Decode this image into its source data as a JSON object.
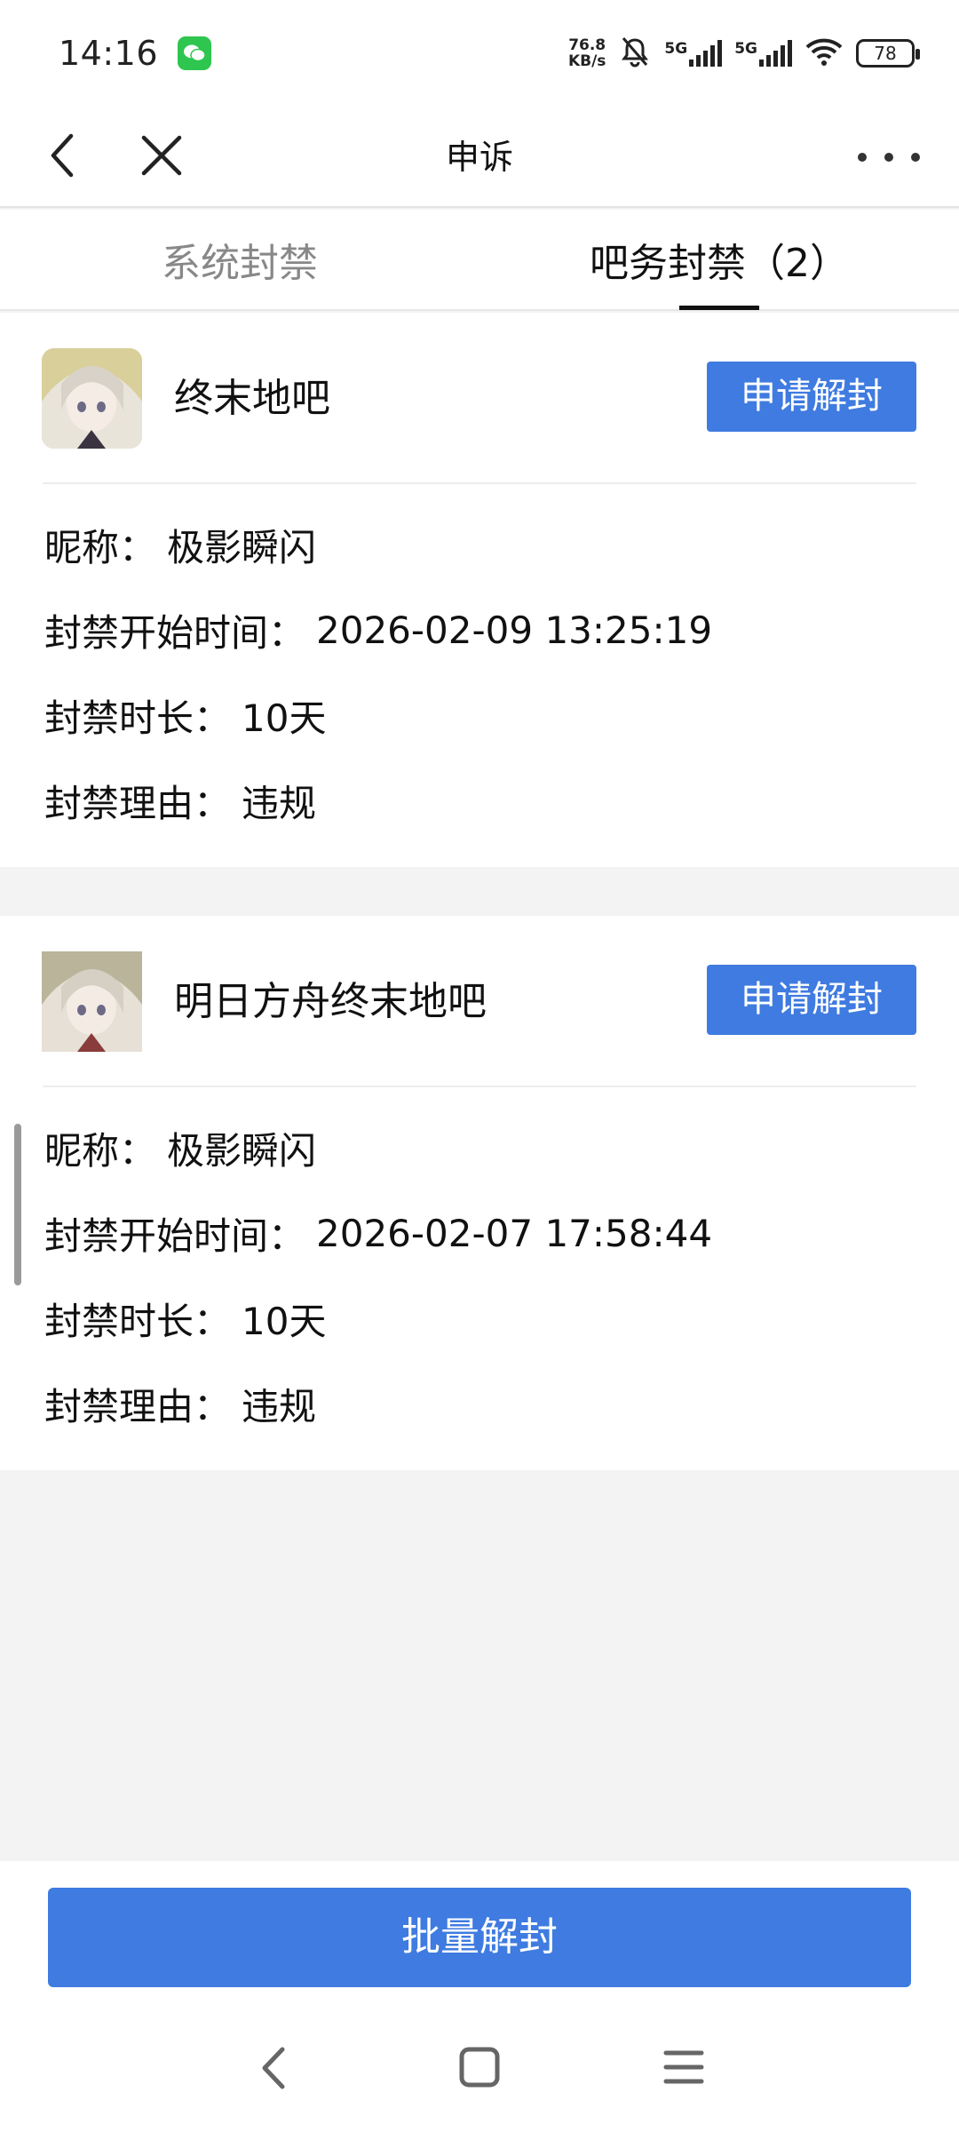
{
  "status_bar": {
    "time": "14:16",
    "net_speed_value": "76.8",
    "net_speed_unit": "KB/s",
    "signal_1_tag": "5G",
    "signal_2_tag": "5G",
    "battery": "78",
    "icons": [
      "wechat-icon",
      "mute-bell-icon",
      "signal-icon",
      "wifi-icon",
      "battery-icon"
    ]
  },
  "header": {
    "title": "申诉"
  },
  "tabs": [
    {
      "label": "系统封禁",
      "active": false
    },
    {
      "label": "吧务封禁（2）",
      "active": true
    }
  ],
  "bans": [
    {
      "forum": "终末地吧",
      "action_label": "申请解封",
      "nickname_label": "昵称：",
      "nickname": "极影瞬闪",
      "start_label": "封禁开始时间：",
      "start_time": "2026-02-09 13:25:19",
      "duration_label": "封禁时长：",
      "duration": "10天",
      "reason_label": "封禁理由：",
      "reason": "违规"
    },
    {
      "forum": "明日方舟终末地吧",
      "action_label": "申请解封",
      "nickname_label": "昵称：",
      "nickname": "极影瞬闪",
      "start_label": "封禁开始时间：",
      "start_time": "2026-02-07 17:58:44",
      "duration_label": "封禁时长：",
      "duration": "10天",
      "reason_label": "封禁理由：",
      "reason": "违规"
    }
  ],
  "footer": {
    "batch_label": "批量解封"
  },
  "colors": {
    "accent": "#3f7be0",
    "background": "#f3f3f4",
    "wechat": "#2ec64f"
  }
}
